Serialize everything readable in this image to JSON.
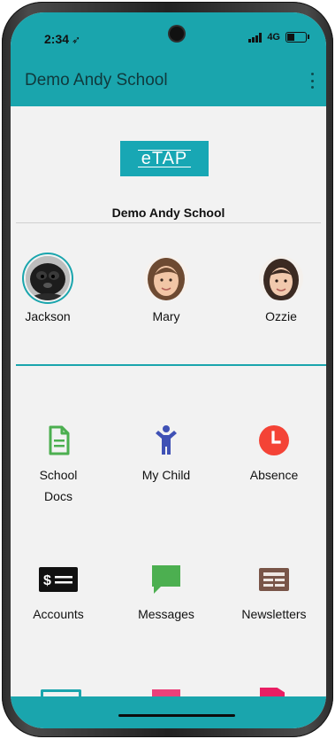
{
  "status_bar": {
    "time": "2:34",
    "network": "4G"
  },
  "app_bar": {
    "title": "Demo Andy School"
  },
  "logo": {
    "text": "eTAP"
  },
  "school": {
    "name": "Demo Andy School"
  },
  "children": [
    {
      "name": "Jackson",
      "selected": true
    },
    {
      "name": "Mary",
      "selected": false
    },
    {
      "name": "Ozzie",
      "selected": false
    }
  ],
  "tiles": {
    "school_docs": {
      "line1": "School",
      "line2": "Docs"
    },
    "my_child": {
      "label": "My Child"
    },
    "absence": {
      "label": "Absence"
    },
    "accounts": {
      "label": "Accounts"
    },
    "messages": {
      "label": "Messages"
    },
    "newsletters": {
      "label": "Newsletters"
    }
  },
  "colors": {
    "brand_teal": "#1aa5ad",
    "docs_green": "#4caf50",
    "child_blue": "#3f51b5",
    "absence_red": "#f44336",
    "messages_green": "#4caf50",
    "newsletters_brown": "#795548"
  }
}
